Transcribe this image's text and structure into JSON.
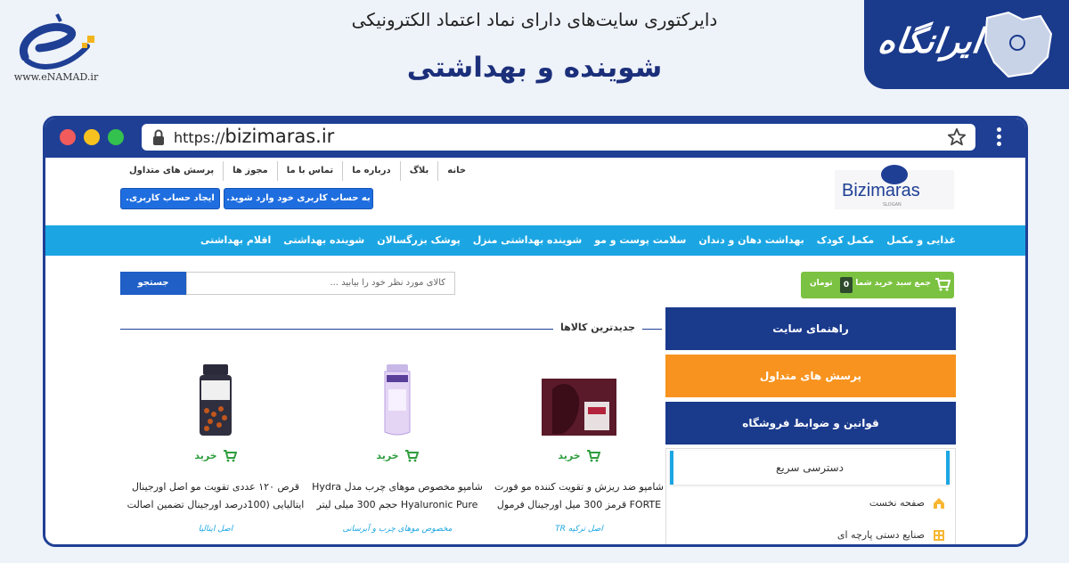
{
  "banner": {
    "title": "دایرکتوری سایت‌های دارای نماد اعتماد الکترونیکی",
    "subtitle": "شوینده و بهداشتی",
    "enamad_text": "www.eNAMAD.ir",
    "brand_logo_text": "ایرانگاه"
  },
  "browser": {
    "url_prefix": "https://",
    "url_domain": "bizimaras.ir"
  },
  "site": {
    "top_nav": [
      "خانه",
      "بلاگ",
      "درباره ما",
      "تماس با ما",
      "مجوز ها",
      "پرسش های متداول"
    ],
    "brand_name": "Bizimaras",
    "brand_slogan": "SLOGAN",
    "login_button": "به حساب کاربری خود وارد شوید.",
    "register_button": "ایجاد حساب کاربری.",
    "categories": [
      "غذایی و مکمل",
      "مکمل کودک",
      "بهداشت دهان و دندان",
      "سلامت پوست و مو",
      "شوینده بهداشتی منزل",
      "پوشک بزرگسالان",
      "شوینده بهداشتی",
      "اقلام بهداشتی"
    ],
    "cart_label": "جمع سبد خرید شما",
    "cart_count": "0",
    "cart_unit": "تومان",
    "search_placeholder": "کالای مورد نظر خود را بیابید ...",
    "search_button": "جستجو",
    "section_title": "جدیدترین کالاها",
    "sidebar": {
      "guide": "راهنمای سایت",
      "faq": "پرسش های متداول",
      "rules": "قوانین و ضوابط فروشگاه",
      "quick_access": "دسترسی سریع",
      "quick_items": [
        "صفحه نخست",
        "صنایع دستی پارچه ای"
      ]
    },
    "products": [
      {
        "buy": "خرید",
        "name": "شامپو ضد ریزش و تقویت کننده مو فورت FORTE قرمز 300 میل اورجینال فرمول",
        "tag": "اصل ترکیه TR"
      },
      {
        "buy": "خرید",
        "name": "شامپو مخصوص موهای چرب مدل Hydra Hyaluronic Pure حجم 300 میلی لیتر",
        "tag": "مخصوص موهای چرب و آبرسانی"
      },
      {
        "buy": "خرید",
        "name": "قرص ۱۲۰ عددی تقویت مو اصل اورجینال ایتالیایی (100درصد اورجینال تضمین اصالت",
        "tag": "اصل ایتالیا"
      }
    ]
  },
  "colors": {
    "navy": "#1a3a8c",
    "sky": "#1ba6e3",
    "orange": "#f7931e",
    "green": "#7cc242"
  }
}
